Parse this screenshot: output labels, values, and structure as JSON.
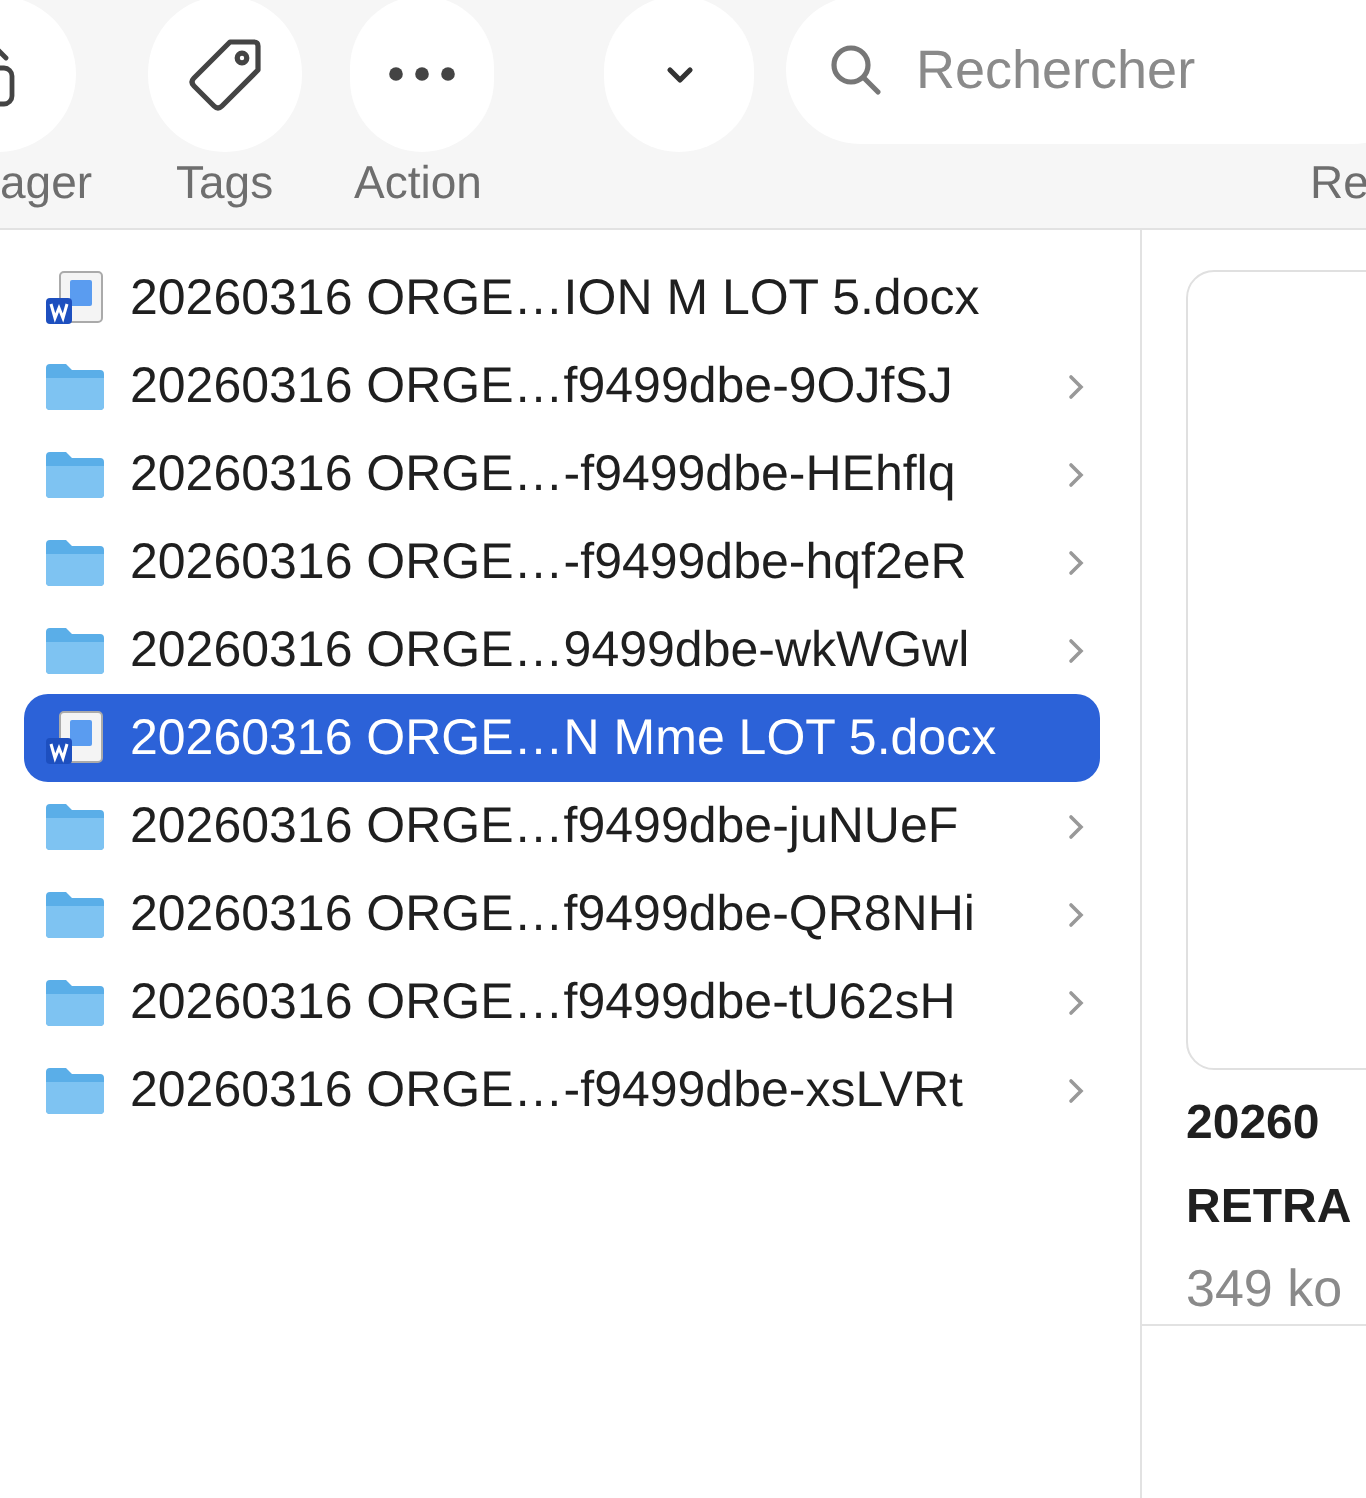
{
  "toolbar": {
    "buttons": [
      {
        "kind": "share",
        "label": "ager"
      },
      {
        "kind": "tags",
        "label": "Tags"
      },
      {
        "kind": "action",
        "label": "Action"
      },
      {
        "kind": "dropdown"
      }
    ],
    "search": {
      "placeholder": "Rechercher",
      "label": "Re"
    }
  },
  "files": [
    {
      "kind": "doc",
      "name": "20260316 ORGE…ION M LOT 5.docx",
      "selected": false
    },
    {
      "kind": "folder",
      "name": "20260316 ORGE…f9499dbe-9OJfSJ",
      "selected": false
    },
    {
      "kind": "folder",
      "name": "20260316 ORGE…-f9499dbe-HEhflq",
      "selected": false
    },
    {
      "kind": "folder",
      "name": "20260316 ORGE…-f9499dbe-hqf2eR",
      "selected": false
    },
    {
      "kind": "folder",
      "name": "20260316 ORGE…9499dbe-wkWGwl",
      "selected": false
    },
    {
      "kind": "doc",
      "name": "20260316 ORGE…N Mme LOT 5.docx",
      "selected": true
    },
    {
      "kind": "folder",
      "name": "20260316 ORGE…f9499dbe-juNUeF",
      "selected": false
    },
    {
      "kind": "folder",
      "name": "20260316 ORGE…f9499dbe-QR8NHi",
      "selected": false
    },
    {
      "kind": "folder",
      "name": "20260316 ORGE…f9499dbe-tU62sH",
      "selected": false
    },
    {
      "kind": "folder",
      "name": "20260316 ORGE…-f9499dbe-xsLVRt",
      "selected": false
    }
  ],
  "preview": {
    "title_lines": [
      "20260",
      "RETRA"
    ],
    "size": "349 ko"
  }
}
